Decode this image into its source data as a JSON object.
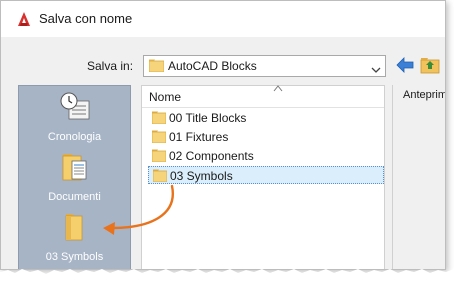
{
  "window": {
    "title": "Salva con nome"
  },
  "save_in": {
    "label": "Salva in:",
    "value": "AutoCAD Blocks"
  },
  "places": [
    {
      "label": "Cronologia",
      "icon": "history-icon"
    },
    {
      "label": "Documenti",
      "icon": "documents-icon"
    },
    {
      "label": "03 Symbols",
      "icon": "folder-icon"
    }
  ],
  "file_list": {
    "column_name": "Nome",
    "items": [
      {
        "name": "00 Title Blocks",
        "selected": false
      },
      {
        "name": "01 Fixtures",
        "selected": false
      },
      {
        "name": "02 Components",
        "selected": false
      },
      {
        "name": "03 Symbols",
        "selected": true
      }
    ]
  },
  "preview": {
    "label": "Anteprima"
  },
  "colors": {
    "places_bg": "#a7b4c6",
    "selection_bg": "#dbeefb",
    "arrow": "#e8731c",
    "app_logo": "#d8302d"
  }
}
